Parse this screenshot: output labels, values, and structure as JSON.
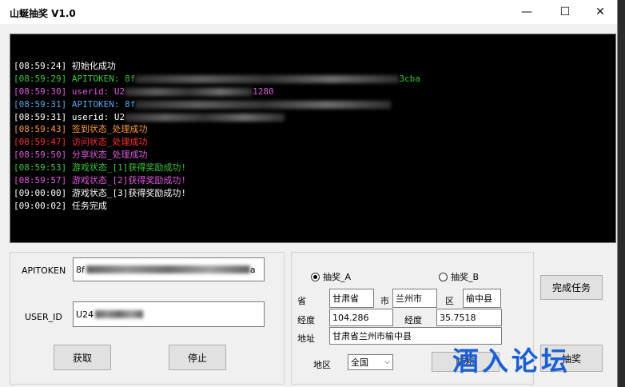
{
  "window": {
    "title": "山蜒抽奖 V1.0",
    "controls": {
      "minimize": "—",
      "maximize": "☐",
      "close": "✕"
    }
  },
  "log": [
    {
      "time": "[08:59:24]",
      "text": "初始化成功",
      "color": "#ffffff",
      "redacted": false
    },
    {
      "time": "[08:59:29]",
      "text": "APITOKEN: 8f",
      "color": "#36c936",
      "redacted": true,
      "tail": "3cba"
    },
    {
      "time": "[08:59:30]",
      "text": "userid: U2",
      "color": "#e05ae0",
      "redacted": true,
      "tail": "1280"
    },
    {
      "time": "[08:59:31]",
      "text": "APITOKEN: 8f",
      "color": "#5aa6e8",
      "redacted": true,
      "tail": ""
    },
    {
      "time": "[08:59:31]",
      "text": "userid: U2",
      "color": "#ffffff",
      "redacted": true,
      "tail": ""
    },
    {
      "time": "[08:59:43]",
      "text": "签到状态_处理成功",
      "color": "#ff9a3a",
      "redacted": false
    },
    {
      "time": "[08:59:47]",
      "text": "访问状态_处理成功",
      "color": "#ff3030",
      "redacted": false
    },
    {
      "time": "[08:59:50]",
      "text": "分享状态_处理成功",
      "color": "#e05ae0",
      "redacted": false
    },
    {
      "time": "[08:59:53]",
      "text": "游戏状态_[1]获得奖励成功!",
      "color": "#36c936",
      "redacted": false
    },
    {
      "time": "[08:59:57]",
      "text": "游戏状态_[2]获得奖励成功!",
      "color": "#e05ae0",
      "redacted": false
    },
    {
      "time": "[09:00:00]",
      "text": "游戏状态_[3]获得奖励成功!",
      "color": "#ffffff",
      "redacted": false
    },
    {
      "time": "[09:00:02]",
      "text": "任务完成",
      "color": "#ffffff",
      "redacted": false
    }
  ],
  "account": {
    "apitoken_label": "APITOKEN",
    "apitoken_value": "8f",
    "apitoken_tail": "a",
    "userid_label": "USER_ID",
    "userid_value": "U24",
    "fetch_button": "获取",
    "stop_button": "停止"
  },
  "lottery": {
    "option_a": "抽奖_A",
    "option_b": "抽奖_B",
    "selected": "A",
    "province_label": "省",
    "province_value": "甘肃省",
    "city_label": "市",
    "city_value": "兰州市",
    "district_label": "区",
    "district_value": "榆中县",
    "longitude_label": "经度",
    "longitude_value": "104.286",
    "latitude_label": "经度",
    "latitude_value": "35.7518",
    "address_label": "地址",
    "address_value": "甘肃省兰州市榆中县",
    "region_label": "地区",
    "region_value": "全国",
    "random_button": "随机"
  },
  "actions": {
    "complete_task_button": "完成任务",
    "draw_button": "抽奖"
  },
  "watermark": "酒入论坛"
}
